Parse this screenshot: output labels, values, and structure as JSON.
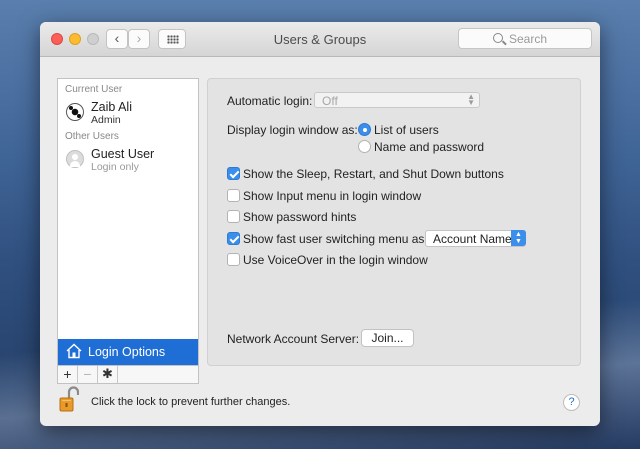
{
  "window": {
    "title": "Users & Groups",
    "search_placeholder": "Search"
  },
  "sidebar": {
    "current_user_header": "Current User",
    "current_user": {
      "name": "Zaib Ali",
      "role": "Admin"
    },
    "other_users_header": "Other Users",
    "other_users": [
      {
        "name": "Guest User",
        "role": "Login only"
      }
    ],
    "login_options_label": "Login Options",
    "toolbar": {
      "add": "+",
      "remove": "−",
      "gear": "✱"
    }
  },
  "login_options": {
    "automatic_login_label": "Automatic login:",
    "automatic_login_value": "Off",
    "display_login_label": "Display login window as:",
    "display_options": [
      {
        "label": "List of users",
        "selected": true
      },
      {
        "label": "Name and password",
        "selected": false
      }
    ],
    "checkboxes": [
      {
        "label": "Show the Sleep, Restart, and Shut Down buttons",
        "checked": true
      },
      {
        "label": "Show Input menu in login window",
        "checked": false
      },
      {
        "label": "Show password hints",
        "checked": false
      },
      {
        "label": "Show fast user switching menu as",
        "checked": true
      },
      {
        "label": "Use VoiceOver in the login window",
        "checked": false
      }
    ],
    "fast_switch_value": "Account Name",
    "network_server_label": "Network Account Server:",
    "join_button": "Join..."
  },
  "footer": {
    "lock_text": "Click the lock to prevent further changes.",
    "help": "?"
  },
  "colors": {
    "accent": "#3b8eea",
    "selection": "#1f6ed6"
  }
}
